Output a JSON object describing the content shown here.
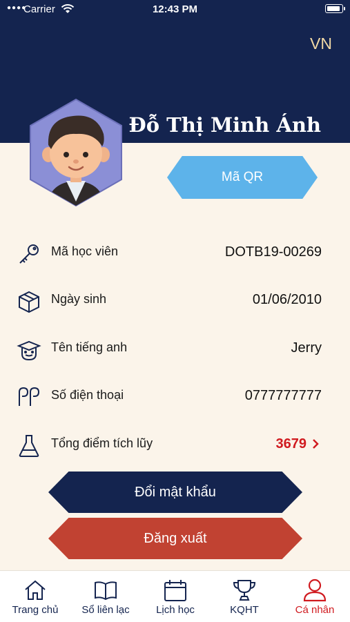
{
  "status_bar": {
    "carrier": "Carrier",
    "time": "12:43 PM"
  },
  "header": {
    "language": "VN",
    "name": "Đỗ Thị Minh Ánh"
  },
  "qr_button": {
    "label": "Mã QR"
  },
  "profile": [
    {
      "icon": "key-icon",
      "label": "Mã học viên",
      "value": "DOTB19-00269"
    },
    {
      "icon": "gift-box-icon",
      "label": "Ngày sinh",
      "value": "01/06/2010"
    },
    {
      "icon": "student-face-icon",
      "label": "Tên tiếng anh",
      "value": "Jerry"
    },
    {
      "icon": "phone-icon",
      "label": "Số điện thoại",
      "value": "0777777777"
    },
    {
      "icon": "flask-icon",
      "label": "Tổng điểm tích lũy",
      "value": "3679"
    }
  ],
  "actions": {
    "change_password": "Đổi mật khẩu",
    "logout": "Đăng xuất"
  },
  "tabs": [
    {
      "icon": "home-icon",
      "label": "Trang chủ"
    },
    {
      "icon": "book-icon",
      "label": "Sổ liên lạc"
    },
    {
      "icon": "calendar-icon",
      "label": "Lịch học"
    },
    {
      "icon": "trophy-icon",
      "label": "KQHT"
    },
    {
      "icon": "user-icon",
      "label": "Cá nhân",
      "active": true
    }
  ],
  "colors": {
    "navy": "#14244f",
    "cream": "#fbf4ea",
    "qr_blue": "#5db3ea",
    "logout_red": "#c14232",
    "accent_red": "#d01a1f"
  }
}
